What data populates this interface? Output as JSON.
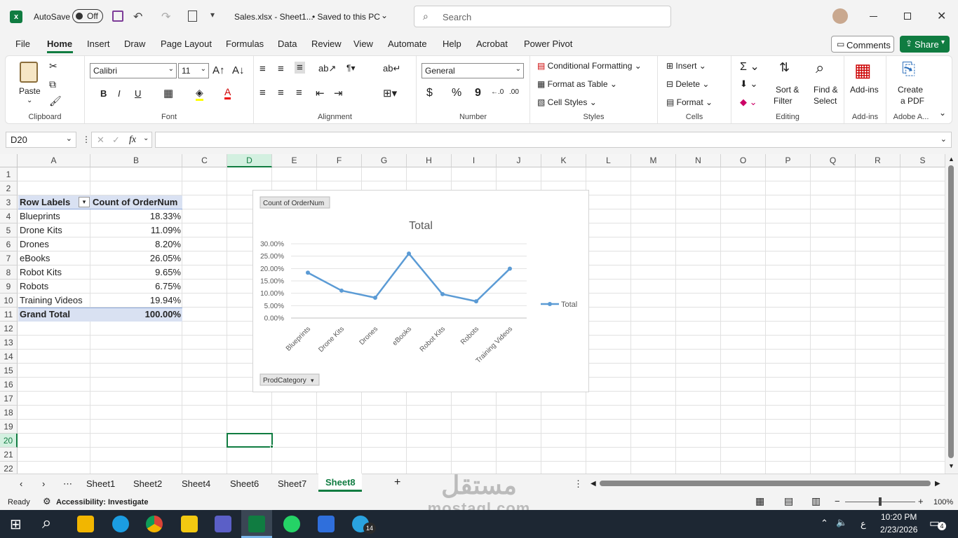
{
  "titlebar": {
    "autosave": "AutoSave",
    "toggle": "Off",
    "filename": "Sales.xlsx - Sheet1...",
    "saved": "• Saved to this PC",
    "search_placeholder": "Search"
  },
  "ribbon_tabs": [
    "File",
    "Home",
    "Insert",
    "Draw",
    "Page Layout",
    "Formulas",
    "Data",
    "Review",
    "View",
    "Automate",
    "Help",
    "Acrobat",
    "Power Pivot"
  ],
  "ribbon_right": {
    "comments": "Comments",
    "share": "Share"
  },
  "clipboard": {
    "paste": "Paste",
    "label": "Clipboard"
  },
  "font": {
    "name": "Calibri",
    "size": "11",
    "label": "Font",
    "bold": "B",
    "italic": "I",
    "underline": "U"
  },
  "alignment": {
    "label": "Alignment"
  },
  "number": {
    "format": "General",
    "label": "Number",
    "currency": "$",
    "percent": "%",
    "comma": "9"
  },
  "styles": {
    "cond": "Conditional Formatting",
    "table": "Format as Table",
    "cell": "Cell Styles",
    "label": "Styles"
  },
  "cells": {
    "insert": "Insert",
    "delete": "Delete",
    "format": "Format",
    "label": "Cells"
  },
  "editing": {
    "sort": "Sort &",
    "filter": "Filter",
    "find": "Find &",
    "select": "Select",
    "label": "Editing"
  },
  "addins": {
    "btn": "Add-ins",
    "label": "Add-ins"
  },
  "adobe": {
    "create": "Create",
    "pdf": "a PDF",
    "label": "Adobe A..."
  },
  "formula": {
    "namebox": "D20",
    "fx": "fx"
  },
  "columns": [
    "A",
    "B",
    "C",
    "D",
    "E",
    "F",
    "G",
    "H",
    "I",
    "J",
    "K",
    "L",
    "M",
    "N",
    "O",
    "P",
    "Q",
    "R",
    "S"
  ],
  "rows": [
    "1",
    "2",
    "3",
    "4",
    "5",
    "6",
    "7",
    "8",
    "9",
    "10",
    "11",
    "12",
    "13",
    "14",
    "15",
    "16",
    "17",
    "18",
    "19",
    "20",
    "21",
    "22"
  ],
  "pivot": {
    "h1": "Row Labels",
    "h2": "Count of OrderNum",
    "rows": [
      {
        "label": "Blueprints",
        "value": "18.33%"
      },
      {
        "label": "Drone Kits",
        "value": "11.09%"
      },
      {
        "label": "Drones",
        "value": "8.20%"
      },
      {
        "label": "eBooks",
        "value": "26.05%"
      },
      {
        "label": "Robot Kits",
        "value": "9.65%"
      },
      {
        "label": "Robots",
        "value": "6.75%"
      },
      {
        "label": "Training Videos",
        "value": "19.94%"
      }
    ],
    "total_label": "Grand Total",
    "total_value": "100.00%"
  },
  "chart_data": {
    "type": "line",
    "title": "Total",
    "field_button": "Count of OrderNum",
    "axis_button": "ProdCategory",
    "categories": [
      "Blueprints",
      "Drone Kits",
      "Drones",
      "eBooks",
      "Robot Kits",
      "Robots",
      "Training Videos"
    ],
    "series": [
      {
        "name": "Total",
        "values": [
          18.33,
          11.09,
          8.2,
          26.05,
          9.65,
          6.75,
          19.94
        ],
        "color": "#5b9bd5"
      }
    ],
    "yticks": [
      "0.00%",
      "5.00%",
      "10.00%",
      "15.00%",
      "20.00%",
      "25.00%",
      "30.00%"
    ],
    "ylim": [
      0,
      30
    ],
    "legend": "right"
  },
  "sheets": [
    "Sheet1",
    "Sheet2",
    "Sheet4",
    "Sheet6",
    "Sheet7",
    "Sheet8"
  ],
  "active_sheet": "Sheet8",
  "status": {
    "ready": "Ready",
    "access": "Accessibility: Investigate",
    "zoom": "100%"
  },
  "taskbar": {
    "time": "10:20 PM",
    "date": "2/23/2026",
    "lang": "ع",
    "notif": "4",
    "badge": "14"
  },
  "watermark": {
    "ar": "مستقل",
    "en": "mostaql.com"
  }
}
